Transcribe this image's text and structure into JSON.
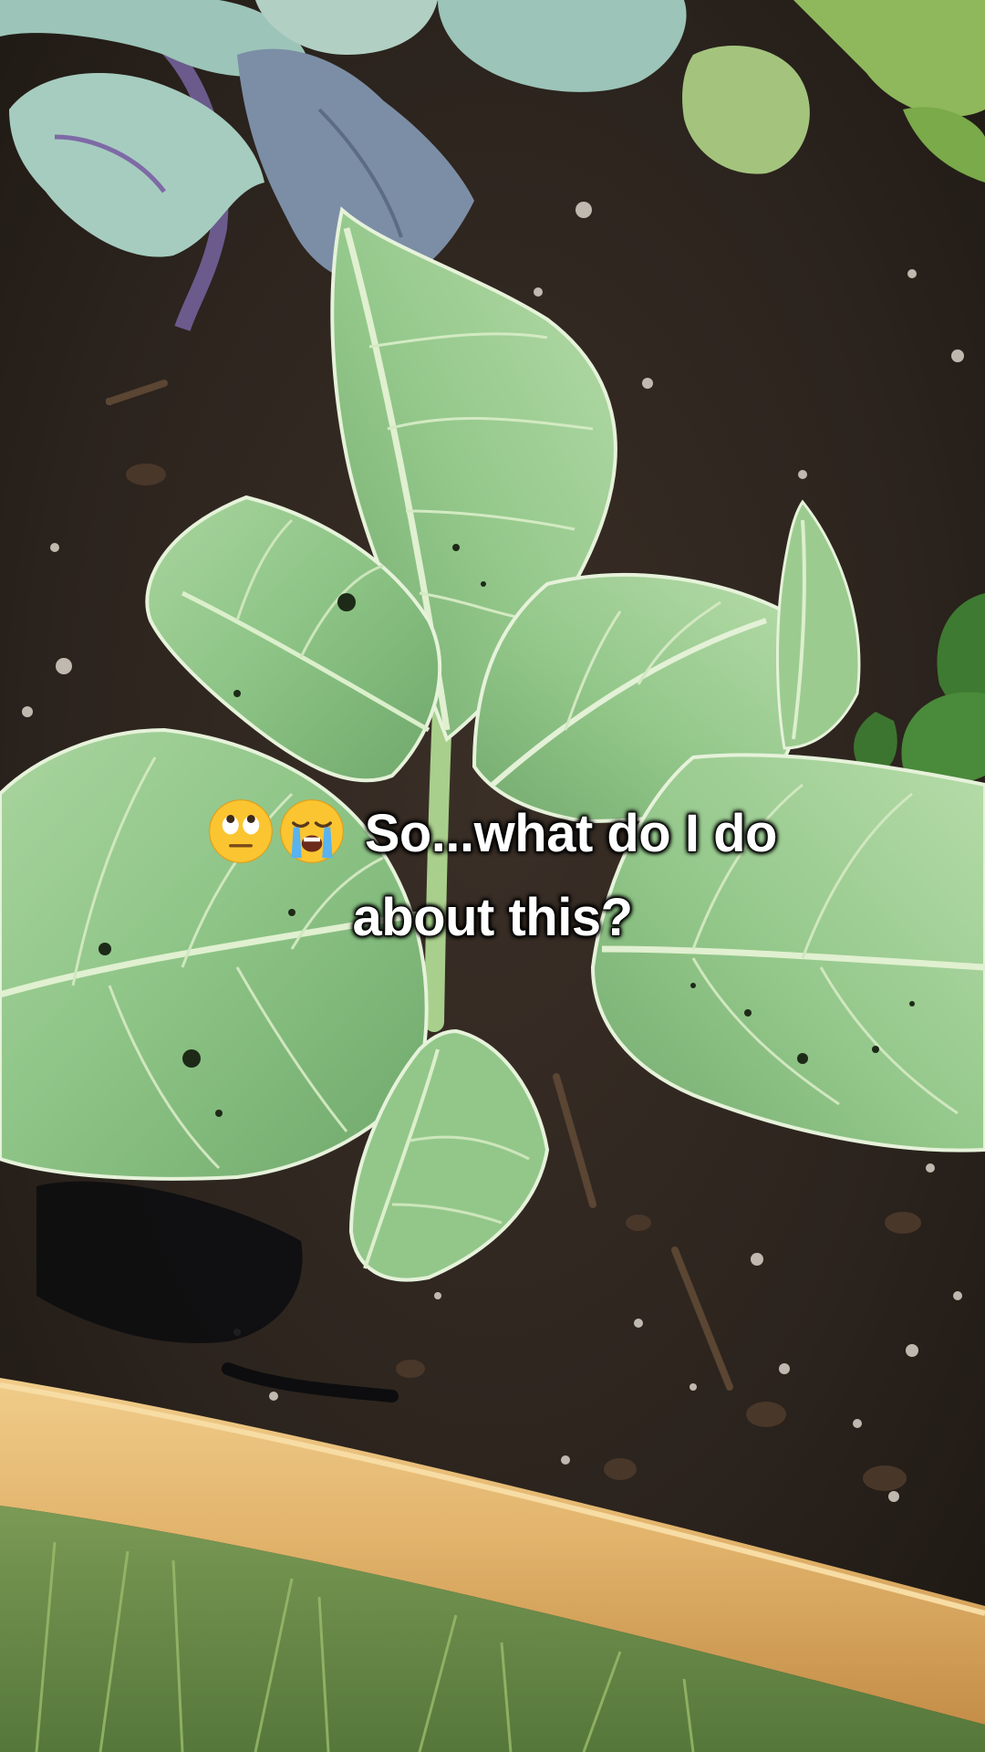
{
  "caption": {
    "emojis": [
      "face-with-rolling-eyes-icon",
      "loudly-crying-face-icon"
    ],
    "line1": "So...what do I do",
    "line2": "about this?"
  },
  "colors": {
    "soil": "#2b231d",
    "leaf_green": "#8fc48a",
    "leaf_vein": "#d8ecc8",
    "kale_blue": "#9cc4b8",
    "wood_frame": "#e2b870",
    "grass": "#6c8f4a"
  }
}
